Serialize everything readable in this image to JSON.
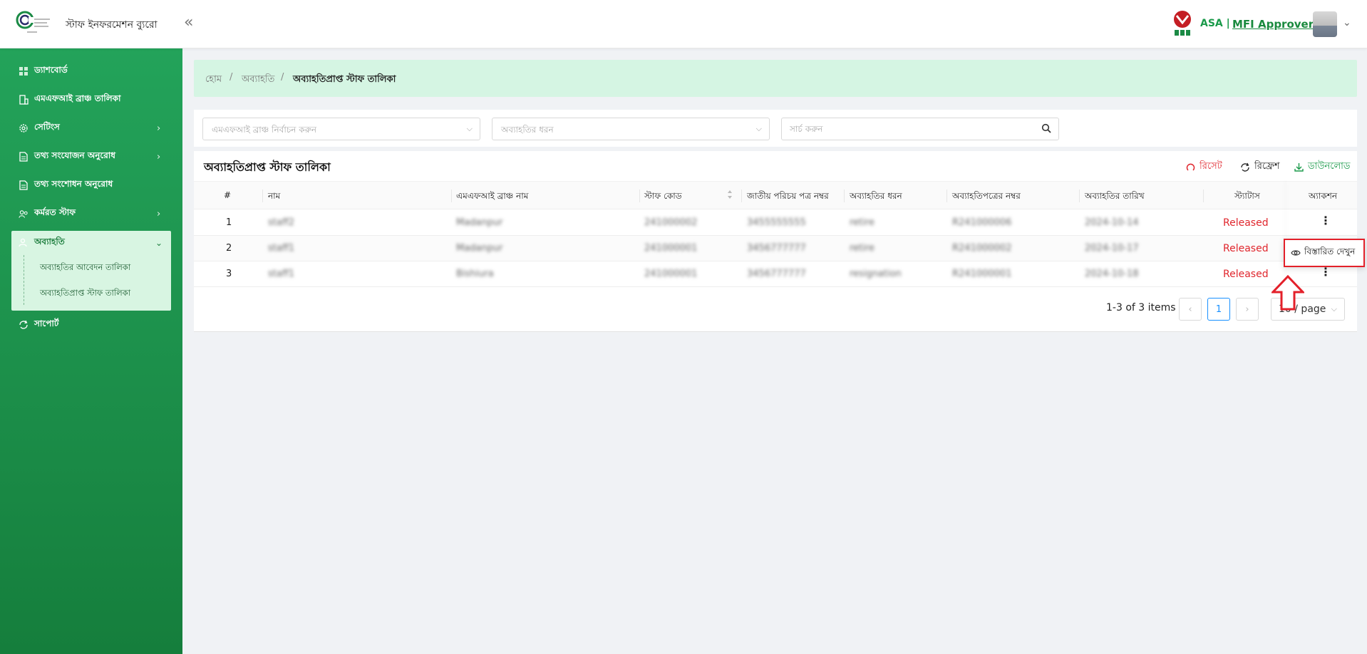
{
  "header": {
    "app_title": "স্টাফ ইনফরমেশন ব্যুরো",
    "collapse_glyph": "«",
    "org_name": "ASA |",
    "role": "MFI Approver",
    "avatar_chevron": "⌄"
  },
  "sidebar": {
    "items": [
      {
        "label": "ড্যাশবোর্ড",
        "icon": "dashboard-icon"
      },
      {
        "label": "এমএফআই ব্রাঞ্চ তালিকা",
        "icon": "building-icon"
      },
      {
        "label": "সেটিংস",
        "icon": "gear-icon",
        "chevron": "›"
      },
      {
        "label": "তথ্য সংযোজন অনুরোধ",
        "icon": "document-icon",
        "chevron": "›"
      },
      {
        "label": "তথ্য সংশোধন অনুরোধ",
        "icon": "document-icon"
      },
      {
        "label": "কর্মরত স্টাফ",
        "icon": "users-icon",
        "chevron": "›"
      },
      {
        "label": "সাপোর্ট",
        "icon": "refresh-icon"
      }
    ],
    "open_group": {
      "label": "অব্যাহতি",
      "chevron": "⌄",
      "sub_items": [
        "অব্যাহতির আবেদন তালিকা",
        "অব্যাহতিপ্রাপ্ত স্টাফ তালিকা"
      ]
    }
  },
  "breadcrumb": {
    "home": "হোম",
    "sep": "/",
    "parent": "অব্যাহতি",
    "current": "অব্যাহতিপ্রাপ্ত স্টাফ তালিকা"
  },
  "filters": {
    "branch_placeholder": "এমএফআই ব্রাঞ্চ নির্বাচন করুন",
    "type_placeholder": "অব্যাহতির ধরন",
    "search_placeholder": "সার্চ করুন",
    "select_arrow": "⌵"
  },
  "table": {
    "title": "অব্যাহতিপ্রাপ্ত স্টাফ তালিকা",
    "actions": {
      "reset": "রিসেট",
      "refresh": "রিফ্রেশ",
      "download": "ডাউনলোড"
    },
    "columns": [
      "#",
      "নাম",
      "এমএফআই ব্রাঞ্চ নাম",
      "স্টাফ কোড",
      "জাতীয় পরিচয় পত্র নম্বর",
      "অব্যাহতির ধরন",
      "অব্যাহতিপত্রের নম্বর",
      "অব্যাহতির তারিখ",
      "স্ট্যাটাস",
      "অ্যাকশন"
    ],
    "rows": [
      {
        "no": "1",
        "name": "staff2",
        "branch": "Madanpur",
        "code": "241000002",
        "nid": "3455555555",
        "type": "retire",
        "letter": "R241000006",
        "date": "2024-10-14",
        "status": "Released"
      },
      {
        "no": "2",
        "name": "staff1",
        "branch": "Madanpur",
        "code": "241000001",
        "nid": "3456777777",
        "type": "retire",
        "letter": "R241000002",
        "date": "2024-10-17",
        "status": "Released"
      },
      {
        "no": "3",
        "name": "staff1",
        "branch": "Bishiura",
        "code": "241000001",
        "nid": "3456777777",
        "type": "resignation",
        "letter": "R241000001",
        "date": "2024-10-18",
        "status": "Released"
      }
    ],
    "row_action_glyph": "⋮"
  },
  "pagination": {
    "summary": "1-3 of 3 items",
    "prev": "‹",
    "current": "1",
    "next": "›",
    "page_size": "10 / page",
    "size_arrow": "⌵"
  },
  "dropdown": {
    "view_details": "বিস্তারিত দেখুন"
  },
  "colors": {
    "brand_green": "#1c8f4a",
    "active_bg": "#d8f5e2",
    "status_red": "#e0262d",
    "annotation_red": "#e3202a",
    "page_active": "#1890ff"
  }
}
